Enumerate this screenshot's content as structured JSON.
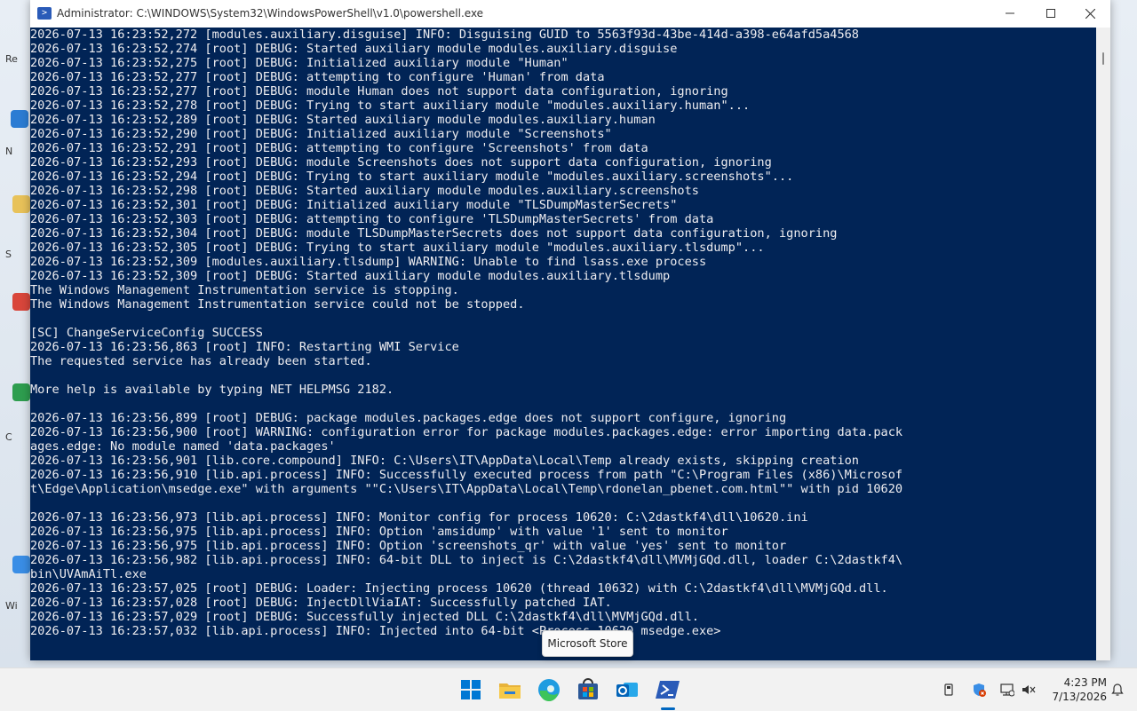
{
  "window": {
    "title": "Administrator: C:\\WINDOWS\\System32\\WindowsPowerShell\\v1.0\\powershell.exe",
    "minimize_label": "—",
    "icon": "powershell-icon"
  },
  "console_lines": [
    "2026-07-13 16:23:52,272 [modules.auxiliary.disguise] INFO: Disguising GUID to 5563f93d-43be-414d-a398-e64afd5a4568",
    "2026-07-13 16:23:52,274 [root] DEBUG: Started auxiliary module modules.auxiliary.disguise",
    "2026-07-13 16:23:52,275 [root] DEBUG: Initialized auxiliary module \"Human\"",
    "2026-07-13 16:23:52,277 [root] DEBUG: attempting to configure 'Human' from data",
    "2026-07-13 16:23:52,277 [root] DEBUG: module Human does not support data configuration, ignoring",
    "2026-07-13 16:23:52,278 [root] DEBUG: Trying to start auxiliary module \"modules.auxiliary.human\"...",
    "2026-07-13 16:23:52,289 [root] DEBUG: Started auxiliary module modules.auxiliary.human",
    "2026-07-13 16:23:52,290 [root] DEBUG: Initialized auxiliary module \"Screenshots\"",
    "2026-07-13 16:23:52,291 [root] DEBUG: attempting to configure 'Screenshots' from data",
    "2026-07-13 16:23:52,293 [root] DEBUG: module Screenshots does not support data configuration, ignoring",
    "2026-07-13 16:23:52,294 [root] DEBUG: Trying to start auxiliary module \"modules.auxiliary.screenshots\"...",
    "2026-07-13 16:23:52,298 [root] DEBUG: Started auxiliary module modules.auxiliary.screenshots",
    "2026-07-13 16:23:52,301 [root] DEBUG: Initialized auxiliary module \"TLSDumpMasterSecrets\"",
    "2026-07-13 16:23:52,303 [root] DEBUG: attempting to configure 'TLSDumpMasterSecrets' from data",
    "2026-07-13 16:23:52,304 [root] DEBUG: module TLSDumpMasterSecrets does not support data configuration, ignoring",
    "2026-07-13 16:23:52,305 [root] DEBUG: Trying to start auxiliary module \"modules.auxiliary.tlsdump\"...",
    "2026-07-13 16:23:52,309 [modules.auxiliary.tlsdump] WARNING: Unable to find lsass.exe process",
    "2026-07-13 16:23:52,309 [root] DEBUG: Started auxiliary module modules.auxiliary.tlsdump",
    "The Windows Management Instrumentation service is stopping.",
    "The Windows Management Instrumentation service could not be stopped.",
    "",
    "[SC] ChangeServiceConfig SUCCESS",
    "2026-07-13 16:23:56,863 [root] INFO: Restarting WMI Service",
    "The requested service has already been started.",
    "",
    "More help is available by typing NET HELPMSG 2182.",
    "",
    "2026-07-13 16:23:56,899 [root] DEBUG: package modules.packages.edge does not support configure, ignoring",
    "2026-07-13 16:23:56,900 [root] WARNING: configuration error for package modules.packages.edge: error importing data.pack",
    "ages.edge: No module named 'data.packages'",
    "2026-07-13 16:23:56,901 [lib.core.compound] INFO: C:\\Users\\IT\\AppData\\Local\\Temp already exists, skipping creation",
    "2026-07-13 16:23:56,910 [lib.api.process] INFO: Successfully executed process from path \"C:\\Program Files (x86)\\Microsof",
    "t\\Edge\\Application\\msedge.exe\" with arguments \"\"C:\\Users\\IT\\AppData\\Local\\Temp\\rdonelan_pbenet.com.html\"\" with pid 10620",
    "",
    "2026-07-13 16:23:56,973 [lib.api.process] INFO: Monitor config for process 10620: C:\\2dastkf4\\dll\\10620.ini",
    "2026-07-13 16:23:56,975 [lib.api.process] INFO: Option 'amsidump' with value '1' sent to monitor",
    "2026-07-13 16:23:56,975 [lib.api.process] INFO: Option 'screenshots_qr' with value 'yes' sent to monitor",
    "2026-07-13 16:23:56,982 [lib.api.process] INFO: 64-bit DLL to inject is C:\\2dastkf4\\dll\\MVMjGQd.dll, loader C:\\2dastkf4\\",
    "bin\\UVAmAiTl.exe",
    "2026-07-13 16:23:57,025 [root] DEBUG: Loader: Injecting process 10620 (thread 10632) with C:\\2dastkf4\\dll\\MVMjGQd.dll.",
    "2026-07-13 16:23:57,028 [root] DEBUG: InjectDllViaIAT: Successfully patched IAT.",
    "2026-07-13 16:23:57,029 [root] DEBUG: Successfully injected DLL C:\\2dastkf4\\dll\\MVMjGQd.dll.",
    "2026-07-13 16:23:57,032 [lib.api.process] INFO: Injected into 64-bit <Process 10620 msedge.exe>"
  ],
  "tooltip": {
    "text": "Microsoft Store"
  },
  "taskbar": {
    "apps": [
      {
        "name": "start",
        "icon": "windows-start-icon"
      },
      {
        "name": "file-explorer",
        "icon": "folder-icon"
      },
      {
        "name": "edge",
        "icon": "edge-icon"
      },
      {
        "name": "microsoft-store",
        "icon": "store-icon"
      },
      {
        "name": "outlook",
        "icon": "outlook-icon"
      },
      {
        "name": "powershell",
        "icon": "powershell-icon"
      }
    ],
    "clock_time": "4:23 PM",
    "clock_date": "7/13/2026"
  },
  "desktop_fragments": [
    "Re",
    "N",
    "S",
    "C",
    "Wi"
  ],
  "colors": {
    "console_bg": "#012456",
    "console_fg": "#eeedf0",
    "accent": "#0067c0"
  }
}
